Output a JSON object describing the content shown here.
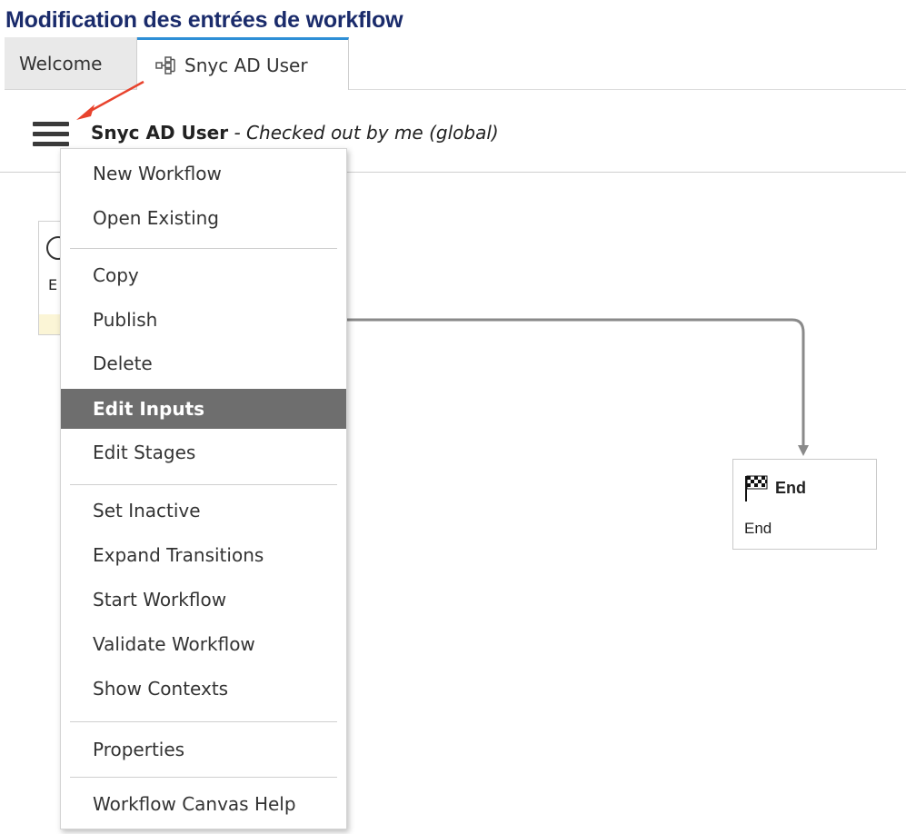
{
  "doc_title": "Modification des entrées de workflow",
  "tabs": [
    {
      "label": "Welcome"
    },
    {
      "label": "Snyc AD User",
      "icon": "workflow-icon",
      "accent": "#2e8fd6"
    }
  ],
  "header": {
    "workflow_name": "Snyc AD User",
    "status": "- Checked out by me  (global)"
  },
  "menu": {
    "items": [
      {
        "label": "New Workflow"
      },
      {
        "label": "Open Existing"
      },
      {
        "label": "Copy"
      },
      {
        "label": "Publish"
      },
      {
        "label": "Delete"
      },
      {
        "label": "Edit Inputs",
        "selected": true
      },
      {
        "label": "Edit Stages"
      },
      {
        "label": "Set Inactive"
      },
      {
        "label": "Expand Transitions"
      },
      {
        "label": "Start Workflow"
      },
      {
        "label": "Validate Workflow"
      },
      {
        "label": "Show Contexts"
      },
      {
        "label": "Properties"
      },
      {
        "label": "Workflow Canvas Help"
      }
    ]
  },
  "canvas": {
    "start_node_partial": "E",
    "end_node": {
      "title": "End",
      "subtitle": "End",
      "icon": "checkered-flag-icon"
    }
  },
  "colors": {
    "title": "#1a2b6b",
    "arrow": "#e8432d",
    "selected_bg": "#6e6e6e"
  }
}
